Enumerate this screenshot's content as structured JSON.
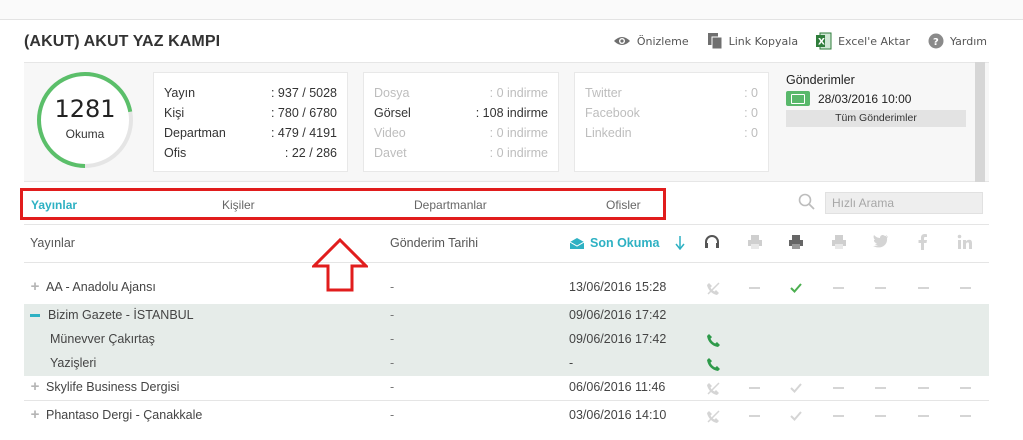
{
  "page": {
    "title": "(AKUT) AKUT YAZ KAMPI"
  },
  "actions": [
    {
      "label": "Önizleme",
      "icon": "eye-icon"
    },
    {
      "label": "Link Kopyala",
      "icon": "copy-icon"
    },
    {
      "label": "Excel'e Aktar",
      "icon": "excel-icon"
    },
    {
      "label": "Yardım",
      "icon": "help-icon"
    }
  ],
  "summary": {
    "gauge": {
      "value": "1281",
      "label": "Okuma",
      "fill_fraction": 0.72,
      "color": "#5bbf6a"
    },
    "counts": [
      {
        "label": "Yayın",
        "value": ": 937 / 5028"
      },
      {
        "label": "Kişi",
        "value": ": 780 / 6780"
      },
      {
        "label": "Departman",
        "value": ": 479 / 4191"
      },
      {
        "label": "Ofis",
        "value": ": 22 / 286"
      }
    ],
    "media": [
      {
        "label": "Dosya",
        "value": ": 0 indirme",
        "active": false
      },
      {
        "label": "Görsel",
        "value": ": 108 indirme",
        "active": true
      },
      {
        "label": "Video",
        "value": ": 0 indirme",
        "active": false
      },
      {
        "label": "Davet",
        "value": ": 0 indirme",
        "active": false
      }
    ],
    "social": [
      {
        "label": "Twitter",
        "value": ": 0"
      },
      {
        "label": "Facebook",
        "value": ": 0"
      },
      {
        "label": "Linkedin",
        "value": ": 0"
      }
    ],
    "gonderimler": {
      "title": "Gönderimler",
      "date": "28/03/2016 10:00",
      "button": "Tüm Gönderimler"
    }
  },
  "tabs": [
    {
      "label": "Yayınlar",
      "active": true
    },
    {
      "label": "Kişiler",
      "active": false
    },
    {
      "label": "Departmanlar",
      "active": false
    },
    {
      "label": "Ofisler",
      "active": false
    }
  ],
  "search": {
    "placeholder": "Hızlı Arama"
  },
  "table": {
    "headers": {
      "name": "Yayınlar",
      "date": "Gönderim Tarihi",
      "last_read": "Son Okuma"
    },
    "rows": [
      {
        "name": "AA - Anadolu Ajansı",
        "date": "-",
        "last": "13/06/2016 15:28",
        "phone": "phone-off"
      },
      {
        "name": "Bizim Gazete - İSTANBUL",
        "date": "-",
        "last": "09/06/2016 17:42",
        "expanded": true
      },
      {
        "name": "Münevver Çakırtaş",
        "date": "-",
        "last": "09/06/2016 17:42",
        "phone": "phone-on",
        "sub": true
      },
      {
        "name": "Yazişleri",
        "date": "-",
        "last": "-",
        "phone": "phone-on",
        "sub": true
      },
      {
        "name": "Skylife Business Dergisi",
        "date": "-",
        "last": "06/06/2016 11:46",
        "phone": "phone-off"
      },
      {
        "name": "Phantaso Dergi - Çanakkale",
        "date": "-",
        "last": "03/06/2016 14:10",
        "phone": "phone-off"
      }
    ]
  }
}
